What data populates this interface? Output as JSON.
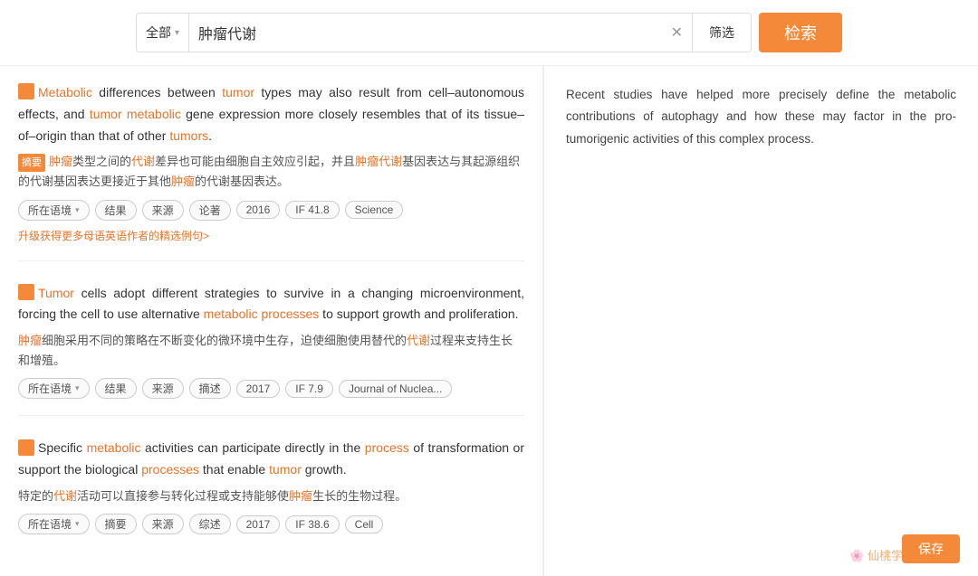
{
  "search": {
    "category_label": "全部",
    "chevron": "▾",
    "query": "肿瘤代谢",
    "clear_icon": "✕",
    "filter_label": "筛选",
    "submit_label": "检索"
  },
  "results": [
    {
      "id": "result-1",
      "en_parts": [
        {
          "text": "Metabolic",
          "highlight": true
        },
        {
          "text": " differences between ",
          "highlight": false
        },
        {
          "text": "tumor",
          "highlight": true
        },
        {
          "text": " types may also result from cell–autonomous effects, and ",
          "highlight": false
        },
        {
          "text": "tumor",
          "highlight": true
        },
        {
          "text": " ",
          "highlight": false
        },
        {
          "text": "metabolic",
          "highlight": true
        },
        {
          "text": " gene expression more closely resembles that of its tissue–of–origin than that of other ",
          "highlight": false
        },
        {
          "text": "tumors",
          "highlight": true
        },
        {
          "text": ".",
          "highlight": false
        }
      ],
      "en_full": "Metabolic differences between tumor types may also result from cell–autonomous effects, and tumor metabolic gene expression more closely resembles that of its tissue–of–origin than that of other tumors.",
      "cn_label": "摘要",
      "cn_text": "肿瘤类型之间的代谢差异也可能由细胞自主效应引起，并且肿瘤代谢基因表达与其起源组织的代谢基因表达更接近于其他肿瘤的代谢基因表达。",
      "cn_highlights": [
        "肿瘤",
        "代谢",
        "肿瘤代谢",
        "肿瘤"
      ],
      "tags": [
        {
          "label": "所在语境",
          "has_arrow": true
        },
        {
          "label": "结果",
          "has_arrow": false
        },
        {
          "label": "来源",
          "has_arrow": false
        },
        {
          "label": "论著",
          "has_arrow": false
        },
        {
          "label": "2016",
          "has_arrow": false
        },
        {
          "label": "IF 41.8",
          "has_arrow": false
        },
        {
          "label": "Science",
          "has_arrow": false
        }
      ],
      "upgrade_text": "升级获得更多母语英语作者的精选例句>"
    },
    {
      "id": "result-2",
      "en_full": "Tumor cells adopt different strategies to survive in a changing microenvironment, forcing the cell to use alternative metabolic processes to support growth and proliferation.",
      "cn_label": null,
      "cn_text": "肿瘤细胞采用不同的策略在不断变化的微环境中生存，迫使细胞使用替代的代谢过程来支持生长和增殖。",
      "tags": [
        {
          "label": "所在语境",
          "has_arrow": true
        },
        {
          "label": "结果",
          "has_arrow": false
        },
        {
          "label": "来源",
          "has_arrow": false
        },
        {
          "label": "摘述",
          "has_arrow": false
        },
        {
          "label": "2017",
          "has_arrow": false
        },
        {
          "label": "IF 7.9",
          "has_arrow": false
        },
        {
          "label": "Journal of Nuclea...",
          "has_arrow": false
        }
      ],
      "upgrade_text": null
    },
    {
      "id": "result-3",
      "en_full": "Specific metabolic activities can participate directly in the process of transformation or support the biological processes that enable tumor growth.",
      "cn_label": null,
      "cn_text": "特定的代谢活动可以直接参与转化过程或支持能够使肿瘤生长的生物过程。",
      "tags": [
        {
          "label": "所在语境",
          "has_arrow": true
        },
        {
          "label": "摘要",
          "has_arrow": false
        },
        {
          "label": "来源",
          "has_arrow": false
        },
        {
          "label": "综述",
          "has_arrow": false
        },
        {
          "label": "2017",
          "has_arrow": false
        },
        {
          "label": "IF 38.6",
          "has_arrow": false
        },
        {
          "label": "Cell",
          "has_arrow": false
        }
      ],
      "upgrade_text": null
    }
  ],
  "right_panel": {
    "text": "Recent studies have helped more precisely define the metabolic contributions of autophagy and how these may factor in the pro-tumorigenic activities of this complex process."
  },
  "watermark": "仙桃学术",
  "save_label": "保存"
}
